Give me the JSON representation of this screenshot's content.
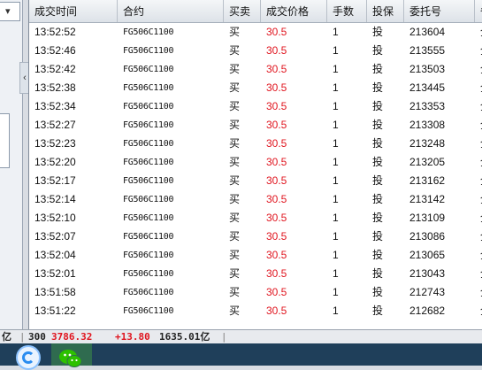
{
  "table": {
    "headers": [
      "成交时间",
      "合约",
      "买卖",
      "成交价格",
      "手数",
      "投保",
      "委托号",
      "备"
    ],
    "rows": [
      {
        "time": "13:52:52",
        "contract": "FG506C1100",
        "side": "买",
        "price": "30.5",
        "qty": "1",
        "type": "投",
        "order": "213604"
      },
      {
        "time": "13:52:46",
        "contract": "FG506C1100",
        "side": "买",
        "price": "30.5",
        "qty": "1",
        "type": "投",
        "order": "213555"
      },
      {
        "time": "13:52:42",
        "contract": "FG506C1100",
        "side": "买",
        "price": "30.5",
        "qty": "1",
        "type": "投",
        "order": "213503"
      },
      {
        "time": "13:52:38",
        "contract": "FG506C1100",
        "side": "买",
        "price": "30.5",
        "qty": "1",
        "type": "投",
        "order": "213445"
      },
      {
        "time": "13:52:34",
        "contract": "FG506C1100",
        "side": "买",
        "price": "30.5",
        "qty": "1",
        "type": "投",
        "order": "213353"
      },
      {
        "time": "13:52:27",
        "contract": "FG506C1100",
        "side": "买",
        "price": "30.5",
        "qty": "1",
        "type": "投",
        "order": "213308"
      },
      {
        "time": "13:52:23",
        "contract": "FG506C1100",
        "side": "买",
        "price": "30.5",
        "qty": "1",
        "type": "投",
        "order": "213248"
      },
      {
        "time": "13:52:20",
        "contract": "FG506C1100",
        "side": "买",
        "price": "30.5",
        "qty": "1",
        "type": "投",
        "order": "213205"
      },
      {
        "time": "13:52:17",
        "contract": "FG506C1100",
        "side": "买",
        "price": "30.5",
        "qty": "1",
        "type": "投",
        "order": "213162"
      },
      {
        "time": "13:52:14",
        "contract": "FG506C1100",
        "side": "买",
        "price": "30.5",
        "qty": "1",
        "type": "投",
        "order": "213142"
      },
      {
        "time": "13:52:10",
        "contract": "FG506C1100",
        "side": "买",
        "price": "30.5",
        "qty": "1",
        "type": "投",
        "order": "213109"
      },
      {
        "time": "13:52:07",
        "contract": "FG506C1100",
        "side": "买",
        "price": "30.5",
        "qty": "1",
        "type": "投",
        "order": "213086"
      },
      {
        "time": "13:52:04",
        "contract": "FG506C1100",
        "side": "买",
        "price": "30.5",
        "qty": "1",
        "type": "投",
        "order": "213065"
      },
      {
        "time": "13:52:01",
        "contract": "FG506C1100",
        "side": "买",
        "price": "30.5",
        "qty": "1",
        "type": "投",
        "order": "213043"
      },
      {
        "time": "13:51:58",
        "contract": "FG506C1100",
        "side": "买",
        "price": "30.5",
        "qty": "1",
        "type": "投",
        "order": "212743"
      },
      {
        "time": "13:51:22",
        "contract": "FG506C1100",
        "side": "买",
        "price": "30.5",
        "qty": "1",
        "type": "投",
        "order": "212682"
      }
    ],
    "row_extras": [
      "全",
      "全",
      "全",
      "全",
      "全",
      "全",
      "全",
      "全",
      "全",
      "全",
      "全",
      "全",
      "全",
      "全",
      "全",
      "全"
    ]
  },
  "status_bar": {
    "left_fragment": "亿",
    "index_code": "300",
    "index_value": "3786.32",
    "index_change": "+13.80",
    "turnover": "1635.01亿"
  },
  "taskbar": {
    "icons": [
      "browser-icon",
      "wechat-icon"
    ]
  },
  "colors": {
    "price_red": "#e0141e",
    "header_bg": "#e6eaef",
    "taskbar_bg": "#1f3f5a",
    "wechat_green": "#2dc100"
  }
}
